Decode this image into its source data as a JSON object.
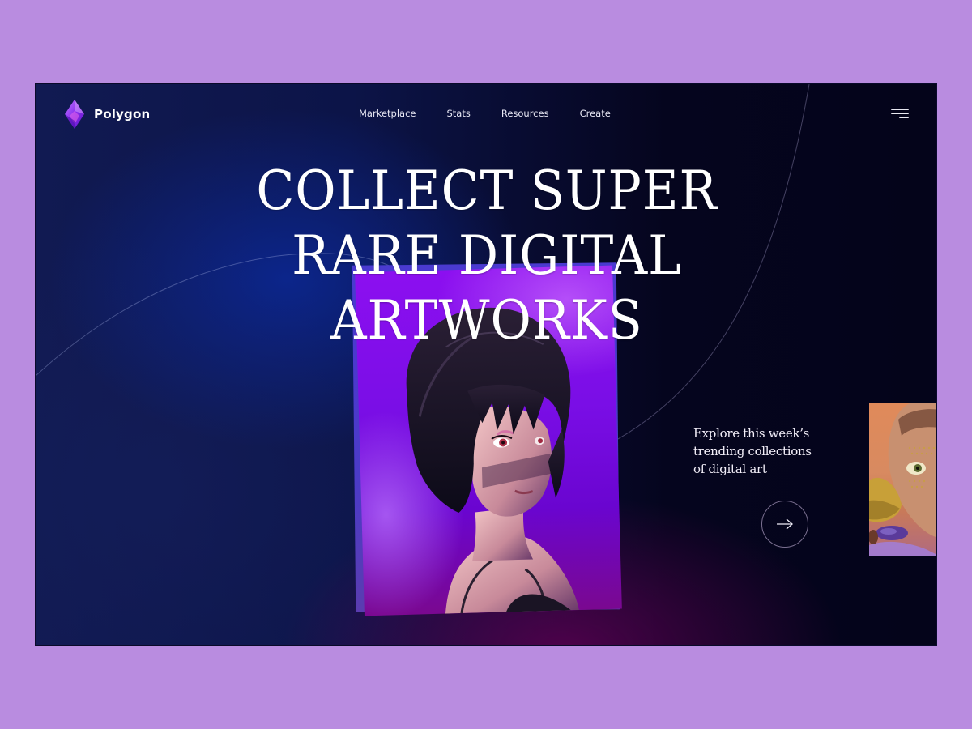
{
  "brand": {
    "name": "Polygon",
    "logo_icon": "polygon-gem-icon"
  },
  "nav": {
    "items": [
      {
        "label": "Marketplace"
      },
      {
        "label": "Stats"
      },
      {
        "label": "Resources"
      },
      {
        "label": "Create"
      }
    ],
    "menu_icon": "hamburger-menu-icon"
  },
  "hero": {
    "headline_lines": [
      "COLLECT SUPER",
      "RARE DIGITAL",
      "ARTWORKS"
    ],
    "featured_art": "anime-girl-bob-haircut-portrait",
    "side_thumbnail": "woman-face-with-fish-artwork"
  },
  "explore": {
    "text_lines": [
      "Explore this week’s",
      "trending collections",
      "of digital art"
    ],
    "arrow_icon": "arrow-right-icon"
  },
  "colors": {
    "page_background": "#b98ce0",
    "hero_dark": "#04041a",
    "hero_blue": "#0c1448",
    "card_purple": "#7a0ee6",
    "card_back_blue": "#4a3ad0",
    "text": "#ffffff"
  }
}
